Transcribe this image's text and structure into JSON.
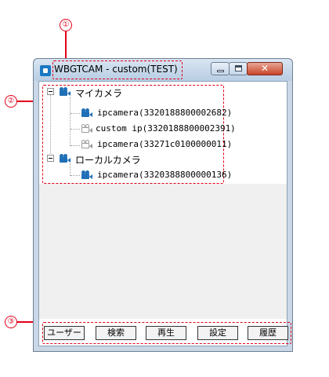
{
  "window": {
    "title": "WBGTCAM - custom(TEST)",
    "close_glyph": "✕"
  },
  "tree": {
    "groups": [
      {
        "label": "マイカメラ",
        "children": [
          "ipcamera(3320188800002682)",
          "custom ip(3320188800002391)",
          "ipcamera(33271c0100000011)"
        ]
      },
      {
        "label": "ローカルカメラ",
        "children": [
          "ipcamera(3320388800000136)"
        ]
      }
    ]
  },
  "buttons": {
    "user": "ユーザー",
    "search": "検索",
    "playback": "再生",
    "settings": "設定",
    "history": "履歴"
  },
  "callouts": {
    "one": "①",
    "two": "②",
    "three": "③"
  },
  "colors": {
    "annotation": "#e0001a",
    "camera_icon": "#1f6fb6"
  }
}
